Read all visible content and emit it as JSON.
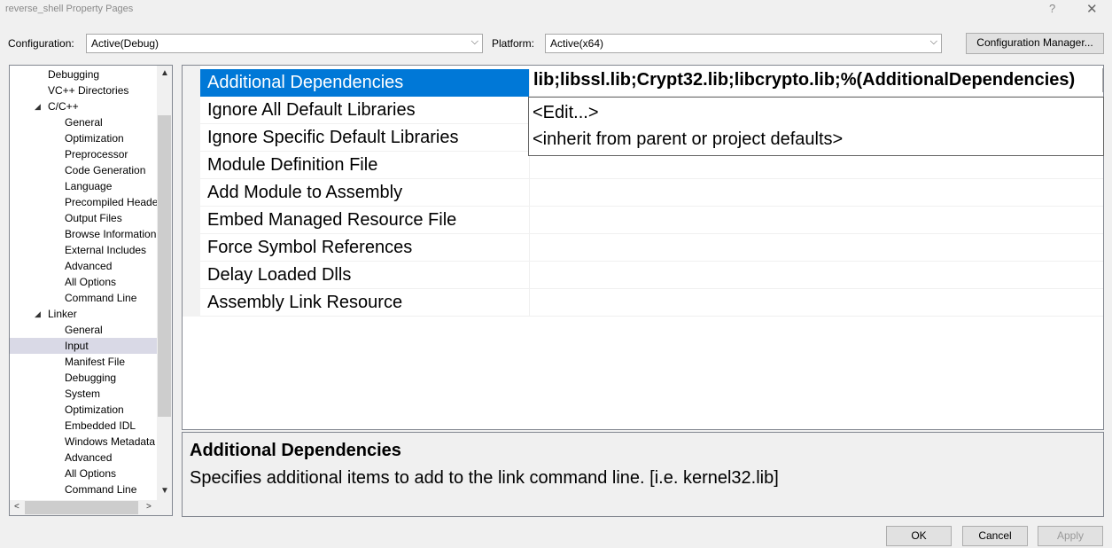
{
  "window": {
    "title": "reverse_shell Property Pages",
    "help_glyph": "?",
    "close_glyph": "✕"
  },
  "config_bar": {
    "configuration_label": "Configuration:",
    "configuration_value": "Active(Debug)",
    "platform_label": "Platform:",
    "platform_value": "Active(x64)",
    "config_manager_label": "Configuration Manager..."
  },
  "tree": {
    "items": [
      {
        "label": "Debugging",
        "level": 1
      },
      {
        "label": "VC++ Directories",
        "level": 1
      },
      {
        "label": "C/C++",
        "level": 1,
        "expanded": true
      },
      {
        "label": "General",
        "level": 2
      },
      {
        "label": "Optimization",
        "level": 2
      },
      {
        "label": "Preprocessor",
        "level": 2
      },
      {
        "label": "Code Generation",
        "level": 2
      },
      {
        "label": "Language",
        "level": 2
      },
      {
        "label": "Precompiled Heade",
        "level": 2
      },
      {
        "label": "Output Files",
        "level": 2
      },
      {
        "label": "Browse Information",
        "level": 2
      },
      {
        "label": "External Includes",
        "level": 2
      },
      {
        "label": "Advanced",
        "level": 2
      },
      {
        "label": "All Options",
        "level": 2
      },
      {
        "label": "Command Line",
        "level": 2
      },
      {
        "label": "Linker",
        "level": 1,
        "expanded": true
      },
      {
        "label": "General",
        "level": 2
      },
      {
        "label": "Input",
        "level": 2,
        "selected": true
      },
      {
        "label": "Manifest File",
        "level": 2
      },
      {
        "label": "Debugging",
        "level": 2
      },
      {
        "label": "System",
        "level": 2
      },
      {
        "label": "Optimization",
        "level": 2
      },
      {
        "label": "Embedded IDL",
        "level": 2
      },
      {
        "label": "Windows Metadata",
        "level": 2
      },
      {
        "label": "Advanced",
        "level": 2
      },
      {
        "label": "All Options",
        "level": 2
      },
      {
        "label": "Command Line",
        "level": 2
      }
    ]
  },
  "properties": [
    {
      "name": "Additional Dependencies",
      "selected": true
    },
    {
      "name": "Ignore All Default Libraries"
    },
    {
      "name": "Ignore Specific Default Libraries"
    },
    {
      "name": "Module Definition File"
    },
    {
      "name": "Add Module to Assembly"
    },
    {
      "name": "Embed Managed Resource File"
    },
    {
      "name": "Force Symbol References"
    },
    {
      "name": "Delay Loaded Dlls"
    },
    {
      "name": "Assembly Link Resource"
    }
  ],
  "selected_value": "lib;libssl.lib;Crypt32.lib;libcrypto.lib;%(AdditionalDependencies)",
  "dropdown_options": [
    "<Edit...>",
    "<inherit from parent or project defaults>"
  ],
  "description": {
    "title": "Additional Dependencies",
    "text": "Specifies additional items to add to the link command line. [i.e. kernel32.lib]"
  },
  "buttons": {
    "ok": "OK",
    "cancel": "Cancel",
    "apply": "Apply"
  },
  "icons": {
    "expanded": "◢",
    "combo_arrow": "⌵",
    "scroll_up": "▲",
    "scroll_down": "▼",
    "scroll_left": "<",
    "scroll_right": ">"
  },
  "colors": {
    "selection_blue": "#0078d7",
    "tree_selected": "#d9d9e6"
  }
}
